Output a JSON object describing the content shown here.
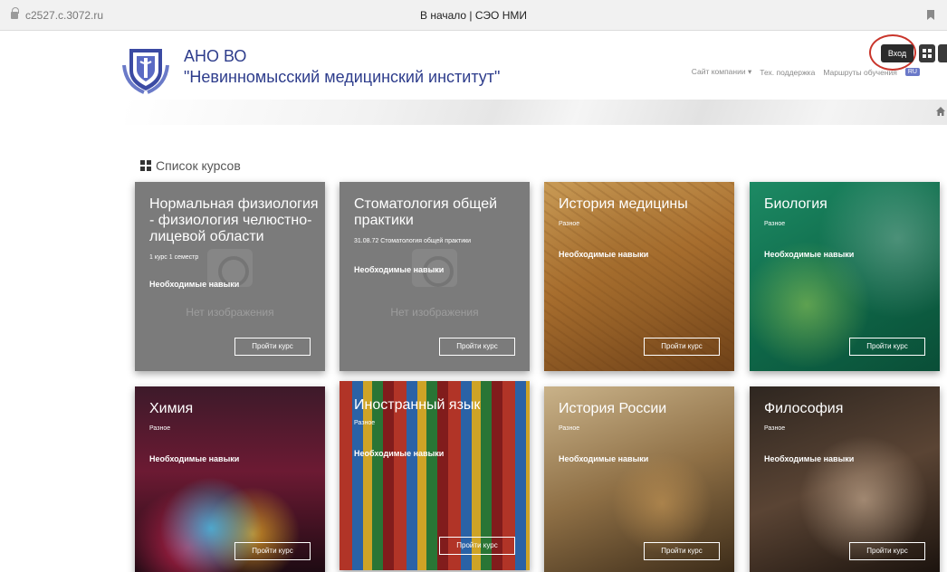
{
  "browser": {
    "url": "c2527.c.3072.ru",
    "tab_title": "В начало | СЭО НМИ"
  },
  "header": {
    "org_line1": "АНО ВО",
    "org_line2": "\"Невинномысский медицинский институт\"",
    "nav": {
      "company_site": "Сайт компании ▾",
      "support": "Тех. поддержка",
      "routes": "Маршруты обучения",
      "lang": "RU"
    },
    "login_label": "Вход"
  },
  "section": {
    "title": "Список курсов"
  },
  "courses": [
    {
      "title": "Нормальная физиология - физиология челюстно-лицевой области",
      "subtitle": "1 курс 1 семестр",
      "skills": "Необходимые навыки",
      "no_image": "Нет изображения",
      "button": "Пройти курс"
    },
    {
      "title": "Стоматология общей практики",
      "subtitle": "31.08.72 Стоматология общей практики",
      "skills": "Необходимые навыки",
      "no_image": "Нет изображения",
      "button": "Пройти курс"
    },
    {
      "title": "История медицины",
      "subtitle": "Разное",
      "skills": "Необходимые навыки",
      "button": "Пройти курс"
    },
    {
      "title": "Биология",
      "subtitle": "Разное",
      "skills": "Необходимые навыки",
      "button": "Пройти курс"
    },
    {
      "title": "Химия",
      "subtitle": "Разное",
      "skills": "Необходимые навыки",
      "button": "Пройти курс"
    },
    {
      "title": "Иностранный язык",
      "subtitle": "Разное",
      "skills": "Необходимые навыки",
      "button": "Пройти курс"
    },
    {
      "title": "История России",
      "subtitle": "Разное",
      "skills": "Необходимые навыки",
      "button": "Пройти курс"
    },
    {
      "title": "Философия",
      "subtitle": "Разное",
      "skills": "Необходимые навыки",
      "button": "Пройти курс"
    }
  ],
  "colors": {
    "brand": "#2e3d8c",
    "placeholder_card": "#7b7b7b",
    "login_button": "#2b2b2b",
    "highlight_ring": "#c9352b"
  }
}
